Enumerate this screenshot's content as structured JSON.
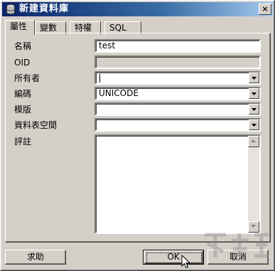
{
  "window": {
    "title": "新建資料庫",
    "close_label": "×"
  },
  "tabs": [
    {
      "label": "屬性",
      "active": true
    },
    {
      "label": "變數",
      "active": false
    },
    {
      "label": "特權",
      "active": false
    },
    {
      "label": "SQL",
      "active": false
    }
  ],
  "form": {
    "name_label": "名稱",
    "name_value": "test",
    "oid_label": "OID",
    "oid_value": "",
    "owner_label": "所有者",
    "owner_value": "",
    "encoding_label": "編碼",
    "encoding_value": "UNICODE",
    "template_label": "模版",
    "template_value": "",
    "tablespace_label": "資料表空間",
    "tablespace_value": "",
    "comment_label": "評註",
    "comment_value": ""
  },
  "buttons": {
    "help_label": "求助",
    "ok_label": "OK",
    "cancel_label": "取消"
  },
  "colors": {
    "titlebar_start": "#0a246a",
    "titlebar_end": "#a6caf0",
    "dialog_face": "#d4d0c8"
  },
  "icons": {
    "title": "database-icon",
    "dropdown": "chevron-down-icon",
    "scroll_up": "arrow-up-icon",
    "scroll_down": "arrow-down-icon",
    "pointer": "mouse-pointer-icon"
  }
}
